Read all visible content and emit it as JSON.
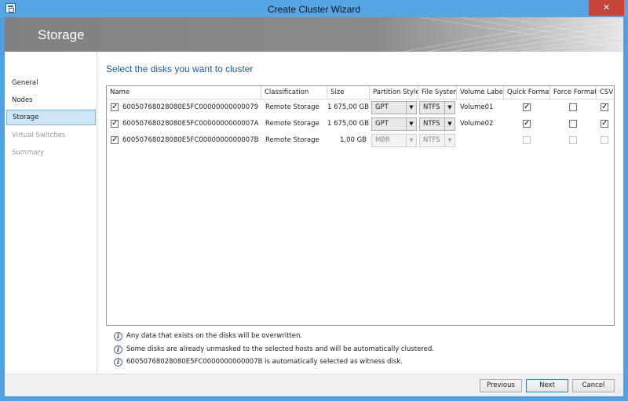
{
  "window": {
    "title": "Create Cluster Wizard",
    "close_glyph": "✕"
  },
  "banner": {
    "title": "Storage"
  },
  "nav": {
    "items": [
      {
        "label": "General",
        "state": "normal"
      },
      {
        "label": "Nodes",
        "state": "normal"
      },
      {
        "label": "Storage",
        "state": "selected"
      },
      {
        "label": "Virtual Switches",
        "state": "disabled"
      },
      {
        "label": "Summary",
        "state": "disabled"
      }
    ]
  },
  "main": {
    "heading": "Select the disks you want to cluster",
    "columns": [
      "Name",
      "Classification",
      "Size",
      "Partition Style",
      "File System",
      "Volume Label",
      "Quick Format",
      "Force Format",
      "CSV"
    ],
    "disks": [
      {
        "selected": true,
        "name": "60050768028080E5FC00000000000079",
        "classification": "Remote Storage",
        "size": "1 675,00 GB",
        "partition_style": "GPT",
        "file_system": "NTFS",
        "volume_label": "Volume01",
        "quick_format": true,
        "force_format": false,
        "csv": true,
        "enabled": true
      },
      {
        "selected": true,
        "name": "60050768028080E5FC0000000000007A",
        "classification": "Remote Storage",
        "size": "1 675,00 GB",
        "partition_style": "GPT",
        "file_system": "NTFS",
        "volume_label": "Volume02",
        "quick_format": true,
        "force_format": false,
        "csv": true,
        "enabled": true
      },
      {
        "selected": true,
        "name": "60050768028080E5FC0000000000007B",
        "classification": "Remote Storage",
        "size": "1,00 GB",
        "partition_style": "MBR",
        "file_system": "NTFS",
        "volume_label": "",
        "quick_format": false,
        "force_format": false,
        "csv": false,
        "enabled": false
      }
    ],
    "info_messages": [
      "Any data that exists on the disks will be overwritten.",
      "Some disks are already unmasked to the selected hosts and will be automatically clustered.",
      "60050768028080E5FC0000000000007B is automatically selected as witness disk."
    ]
  },
  "footer": {
    "previous_label": "Previous",
    "next_label": "Next",
    "cancel_label": "Cancel"
  },
  "icons": {
    "info": "info-icon",
    "app": "wizard-app-icon",
    "check": "✓",
    "dropdown": "▼"
  }
}
